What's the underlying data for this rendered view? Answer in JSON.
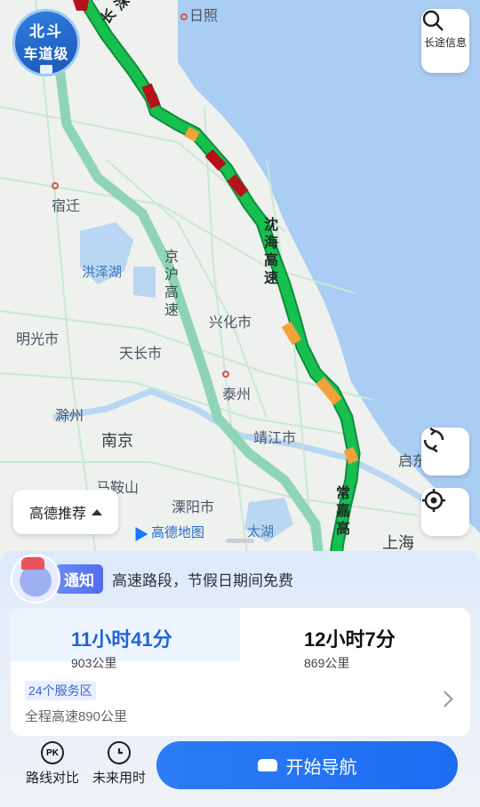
{
  "map": {
    "beidou_badge": {
      "line1": "北斗",
      "line2": "车道级"
    },
    "cities": [
      "日照",
      "宿迁",
      "明光市",
      "天长市",
      "兴化市",
      "泰州",
      "滁州",
      "南京",
      "靖江市",
      "马鞍山",
      "溧阳市",
      "上海",
      "启东"
    ],
    "lakes": [
      "洪泽湖",
      "太湖"
    ],
    "road_labels": {
      "changshen": "长深高速",
      "shenhai": "沈海高速",
      "jinghu": "京沪高速",
      "changjia": "常嘉高"
    },
    "logo": "高德地图"
  },
  "buttons": {
    "long_trip_info": "长途信息",
    "route_recommend": "高德推荐"
  },
  "notice": {
    "tag": "通知",
    "text": "高速路段，节假日期间免费"
  },
  "routes": [
    {
      "time": "11小时41分",
      "distance": "903公里",
      "selected": true
    },
    {
      "time": "12小时7分",
      "distance": "869公里",
      "selected": false
    }
  ],
  "route_detail": {
    "service_areas": "24个服务区",
    "highway_info": "全程高速890公里"
  },
  "toolbar": {
    "compare_label": "路线对比",
    "future_label": "未来用时",
    "start_label": "开始导航"
  },
  "colors": {
    "accent": "#2c7cf7",
    "route_green": "#12b84a",
    "congestion_red": "#b5121b",
    "slow_yellow": "#f2a23a"
  }
}
